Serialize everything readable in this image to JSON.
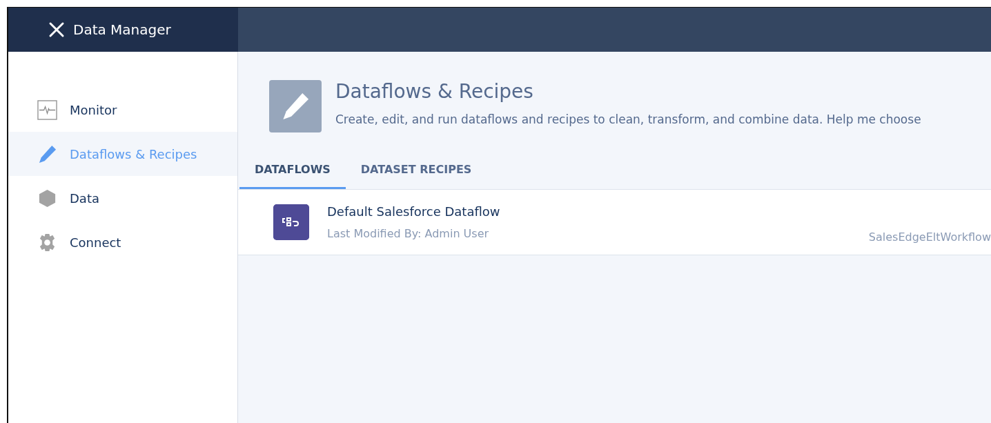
{
  "app": {
    "title": "Data Manager"
  },
  "sidebar": {
    "items": [
      {
        "label": "Monitor",
        "kind": "monitor",
        "selected": false
      },
      {
        "label": "Dataflows & Recipes",
        "kind": "pencil",
        "selected": true
      },
      {
        "label": "Data",
        "kind": "hexagon",
        "selected": false
      },
      {
        "label": "Connect",
        "kind": "gear",
        "selected": false
      }
    ]
  },
  "page_header": {
    "title": "Dataflows & Recipes",
    "description": "Create, edit, and run dataflows and recipes to clean, transform, and combine data. Help me choose"
  },
  "tabs": [
    {
      "label": "DATAFLOWS",
      "selected": true
    },
    {
      "label": "DATASET RECIPES",
      "selected": false
    }
  ],
  "dataflows": [
    {
      "name": "Default Salesforce Dataflow",
      "modified": "Last Modified By: Admin User",
      "column_2": "SalesEdgeEltWorkflow"
    }
  ]
}
